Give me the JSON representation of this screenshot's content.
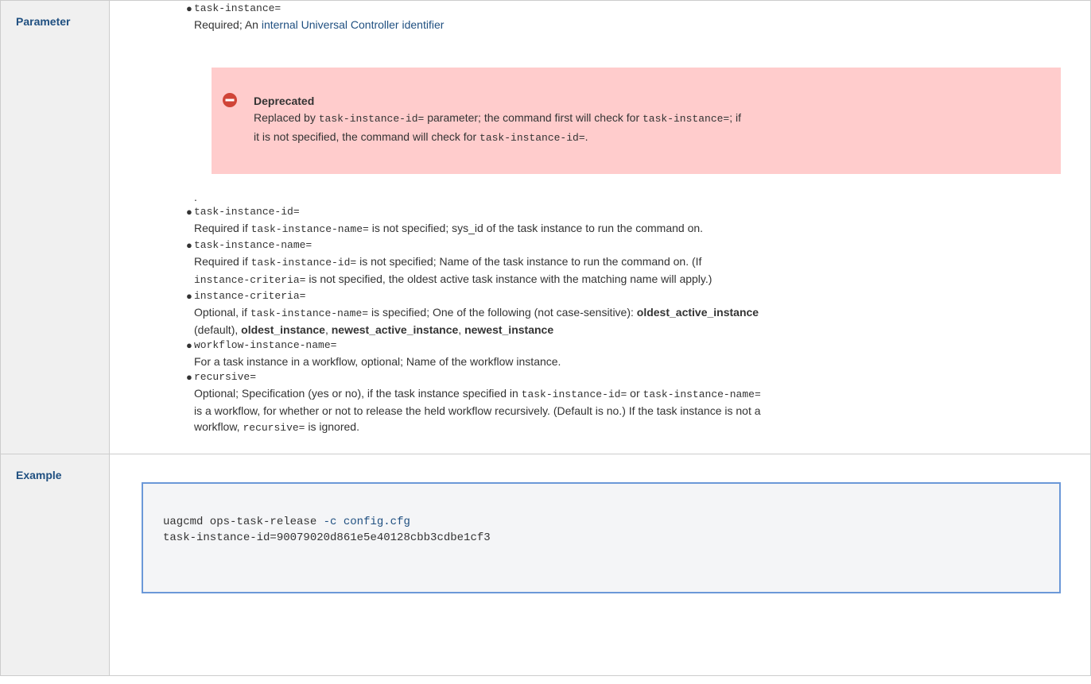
{
  "headers": {
    "parameter": "Parameter",
    "example": "Example"
  },
  "params": [
    {
      "code": "task-instance=",
      "desc_prefix": "Required; An ",
      "desc_link": "internal Universal Controller identifier"
    },
    {
      "code": "task-instance-id=",
      "desc_a": "Required if ",
      "desc_code": "task-instance-name=",
      "desc_b": " is not specified; sys_id of the task instance to run the command on."
    },
    {
      "code": "task-instance-name=",
      "desc_a": "Required if ",
      "desc_code": "task-instance-id=",
      "desc_b": " is not specified; Name of the task instance to run the command on. (If",
      "desc_code2": "instance-criteria=",
      "desc_c": " is not specified, the oldest active task instance with the matching name will apply.)"
    },
    {
      "code": "instance-criteria=",
      "desc_a": "Optional, if ",
      "desc_code": "task-instance-name=",
      "desc_b": " is specified; One of the following (not case-sensitive): ",
      "opt1": "oldest_active_instance",
      "desc_c": "(default), ",
      "opt2": "oldest_instance",
      "sep1": ", ",
      "opt3": "newest_active_instance",
      "sep2": ", ",
      "opt4": "newest_instance"
    },
    {
      "code": "workflow-instance-name=",
      "desc": "For a task instance in a workflow, optional; Name of the workflow instance."
    },
    {
      "code": "recursive=",
      "desc_a": "Optional; Specification (yes or no), if the task instance specified in ",
      "desc_code": "task-instance-id=",
      "desc_b": " or ",
      "desc_code2": "task-instance-name=",
      "desc_c": "is a workflow, for whether or not to release the held workflow recursively. (Default is no.) If the task instance is not a",
      "desc_d": "workflow, ",
      "desc_code3": "recursive=",
      "desc_e": " is ignored."
    }
  ],
  "panel": {
    "title": "Deprecated",
    "text_a": "Replaced by ",
    "code_a": "task-instance-id=",
    "text_b": " parameter; the command first will check for ",
    "code_b": "task-instance=",
    "text_c": "; if",
    "text_d": "it is not specified, the command will check for ",
    "code_c": "task-instance-id=",
    "text_e": "."
  },
  "dot_text": ".",
  "example": {
    "cmd": "uagcmd ops-task-release ",
    "flag": "-c",
    "space": " ",
    "file": "config.cfg",
    "line2": "task-instance-id=90079020d861e5e40128cbb3cdbe1cf3"
  },
  "colors": {
    "link": "#205081",
    "panel_bg": "#ffcccc",
    "code_border": "#6b98d8",
    "header_bg": "#f0f0f0",
    "error_icon": "#d04437"
  }
}
